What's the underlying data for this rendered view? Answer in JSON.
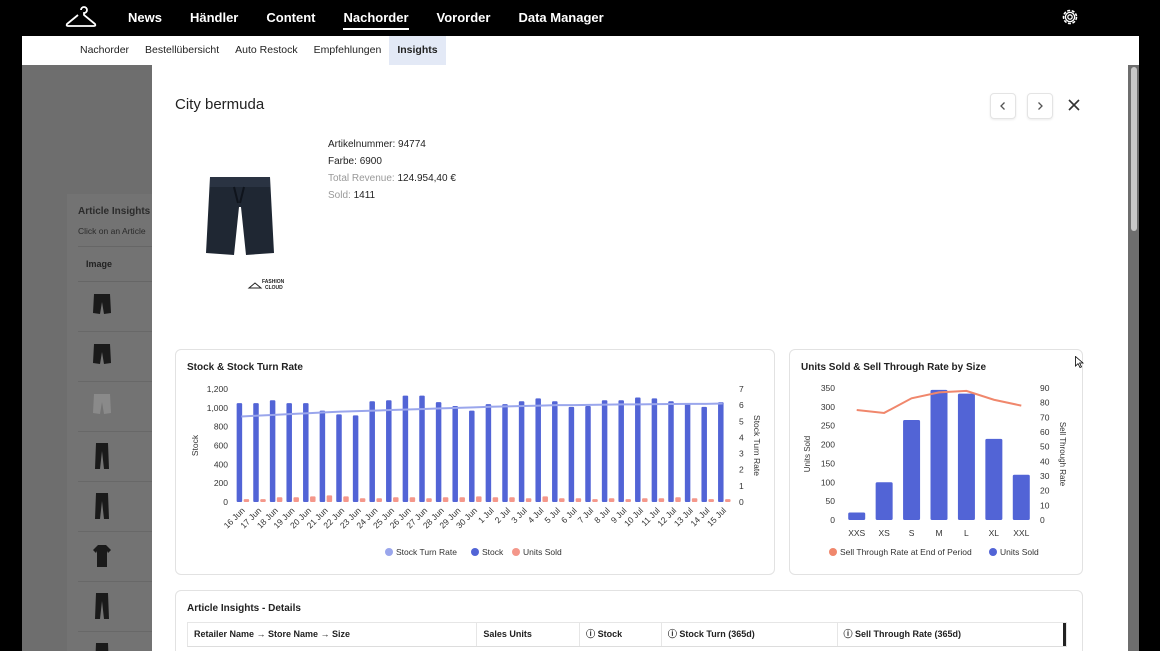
{
  "topnav": {
    "items": [
      {
        "label": "News",
        "active": false
      },
      {
        "label": "Händler",
        "active": false
      },
      {
        "label": "Content",
        "active": false
      },
      {
        "label": "Nachorder",
        "active": true
      },
      {
        "label": "Vororder",
        "active": false
      },
      {
        "label": "Data Manager",
        "active": false
      }
    ],
    "logo_icon": "hanger-icon",
    "settings_icon": "gear-icon"
  },
  "subnav": {
    "items": [
      {
        "label": "Nachorder",
        "active": false
      },
      {
        "label": "Bestellübersicht",
        "active": false
      },
      {
        "label": "Auto Restock",
        "active": false
      },
      {
        "label": "Empfehlungen",
        "active": false
      },
      {
        "label": "Insights",
        "active": true
      }
    ],
    "active_bg": "#e3e9f6"
  },
  "left_panel": {
    "title": "Article Insights",
    "subtitle": "Click on an Article",
    "column_header": "Image",
    "rows": [
      "shorts",
      "shorts",
      "shorts-light",
      "trousers",
      "trousers",
      "tshirt",
      "trousers",
      "trousers"
    ]
  },
  "modal": {
    "title": "City bermuda",
    "article_number_label": "Artikelnummer:",
    "article_number": "94774",
    "color_label": "Farbe:",
    "color": "6900",
    "revenue_label": "Total Revenue:",
    "revenue": "124.954,40 €",
    "sold_label": "Sold:",
    "sold": "1411",
    "brand": "FASHION CLOUD"
  },
  "chart1": {
    "title": "Stock & Stock Turn Rate",
    "ylabel_left": "Stock",
    "ylabel_right": "Stock Turn Rate",
    "legend": [
      "Stock Turn Rate",
      "Stock",
      "Units Sold"
    ]
  },
  "chart2": {
    "title": "Units Sold & Sell Through Rate by Size",
    "ylabel_left": "Units Sold",
    "ylabel_right": "Sell Through Rate",
    "legend": [
      "Sell Through Rate at End of Period",
      "Units Sold"
    ]
  },
  "details": {
    "title": "Article Insights - Details",
    "columns": [
      "Retailer Name → Store Name → Size",
      "Sales Units",
      "ⓘ Stock",
      "ⓘ Stock Turn (365d)",
      "ⓘ Sell Through Rate (365d)"
    ]
  },
  "colors": {
    "stock": "#5264d6",
    "units_sold": "#f4978a",
    "turn_rate": "#9aa6ec",
    "sell_through": "#f0876c"
  },
  "chart_data": [
    {
      "type": "bar",
      "categories": [
        "16 Jun",
        "17 Jun",
        "18 Jun",
        "19 Jun",
        "20 Jun",
        "21 Jun",
        "22 Jun",
        "23 Jun",
        "24 Jun",
        "25 Jun",
        "26 Jun",
        "27 Jun",
        "28 Jun",
        "29 Jun",
        "30 Jun",
        "1 Jul",
        "2 Jul",
        "3 Jul",
        "4 Jul",
        "5 Jul",
        "6 Jul",
        "7 Jul",
        "8 Jul",
        "9 Jul",
        "10 Jul",
        "11 Jul",
        "12 Jul",
        "13 Jul",
        "14 Jul",
        "15 Jul"
      ],
      "series": [
        {
          "name": "Stock",
          "axis": "left",
          "values": [
            1050,
            1050,
            1080,
            1050,
            1050,
            970,
            930,
            920,
            1070,
            1080,
            1130,
            1130,
            1060,
            1020,
            970,
            1040,
            1040,
            1070,
            1100,
            1070,
            1010,
            1020,
            1080,
            1080,
            1110,
            1100,
            1070,
            1050,
            1010,
            1060
          ]
        },
        {
          "name": "Units Sold",
          "axis": "left",
          "values": [
            30,
            30,
            50,
            50,
            60,
            70,
            60,
            40,
            40,
            50,
            50,
            40,
            50,
            50,
            60,
            50,
            50,
            40,
            60,
            40,
            40,
            30,
            40,
            30,
            40,
            40,
            50,
            40,
            30,
            30
          ]
        },
        {
          "name": "Stock Turn Rate",
          "axis": "right",
          "values": [
            5.3,
            5.35,
            5.4,
            5.45,
            5.5,
            5.55,
            5.6,
            5.63,
            5.66,
            5.7,
            5.73,
            5.76,
            5.8,
            5.83,
            5.86,
            5.9,
            5.92,
            5.95,
            5.97,
            6.0,
            6.0,
            6.02,
            6.03,
            6.05,
            6.05,
            6.06,
            6.07,
            6.08,
            6.08,
            6.1
          ]
        }
      ],
      "title": "Stock & Stock Turn Rate",
      "ylabel": "Stock",
      "ylabel_right": "Stock Turn Rate",
      "ylim": [
        0,
        1200
      ],
      "ylim_right": [
        0,
        7
      ],
      "yticks": [
        0,
        200,
        400,
        600,
        800,
        1000,
        1200
      ],
      "ytick_labels": [
        "0",
        "200",
        "400",
        "600",
        "800",
        "1,000",
        "1,200"
      ],
      "yticks_right": [
        0,
        1,
        2,
        3,
        4,
        5,
        6,
        7
      ],
      "legend": "bottom"
    },
    {
      "type": "bar",
      "categories": [
        "XXS",
        "XS",
        "S",
        "M",
        "L",
        "XL",
        "XXL"
      ],
      "series": [
        {
          "name": "Units Sold",
          "axis": "left",
          "values": [
            20,
            100,
            265,
            345,
            335,
            215,
            120
          ]
        },
        {
          "name": "Sell Through Rate at End of Period",
          "axis": "right",
          "values": [
            75,
            73,
            83,
            87,
            88,
            82,
            78
          ]
        }
      ],
      "title": "Units Sold & Sell Through Rate by Size",
      "ylabel": "Units Sold",
      "ylabel_right": "Sell Through Rate",
      "ylim": [
        0,
        350
      ],
      "ylim_right": [
        0,
        90
      ],
      "yticks": [
        0,
        50,
        100,
        150,
        200,
        250,
        300,
        350
      ],
      "yticks_right": [
        0,
        10,
        20,
        30,
        40,
        50,
        60,
        70,
        80,
        90
      ],
      "legend": "bottom"
    }
  ]
}
